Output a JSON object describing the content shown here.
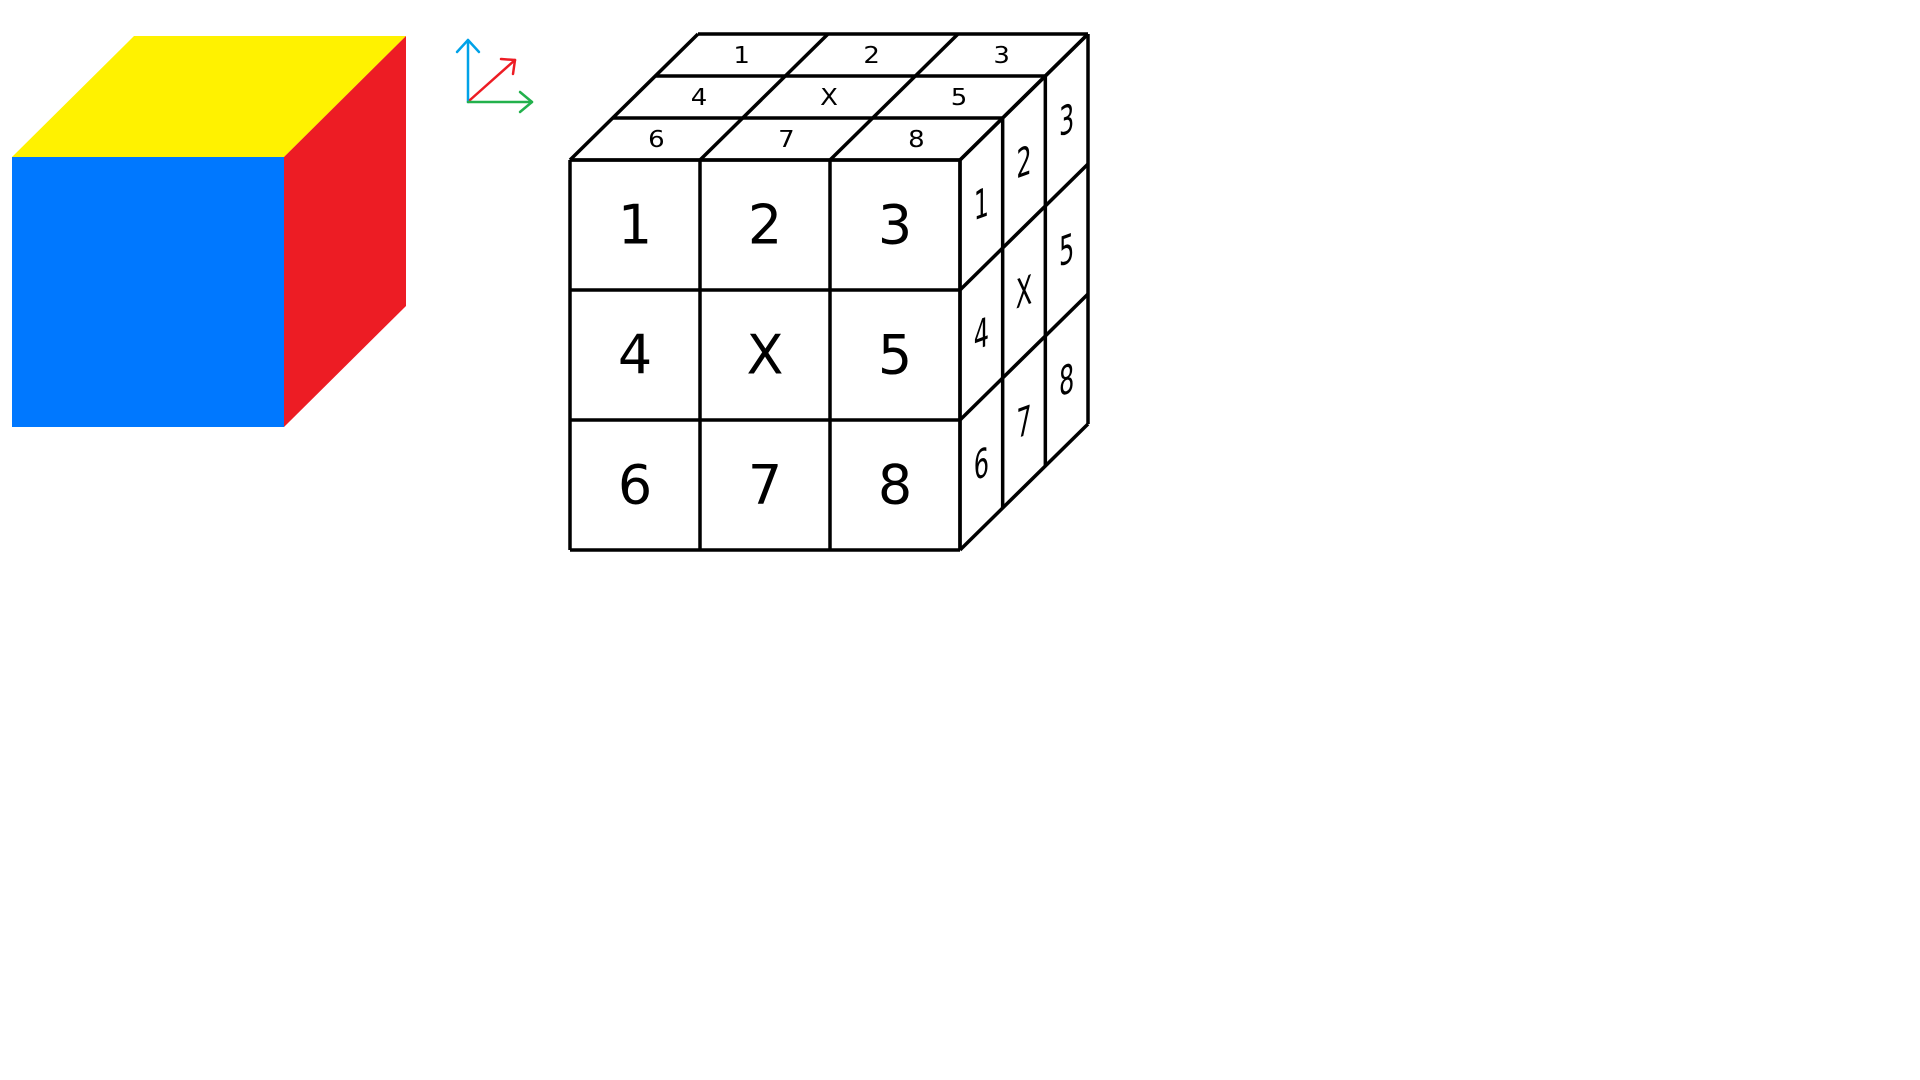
{
  "colors": {
    "outline": "#000000",
    "top_face": "#FFF200",
    "front_face": "#0078FF",
    "right_face": "#ED1C24",
    "axis_up": "#00A2E8",
    "axis_diagonal": "#ED1C24",
    "axis_right": "#22B14C"
  },
  "axes_legend": {
    "arrows": [
      "axis-up-arrow",
      "axis-diagonal-arrow",
      "axis-right-arrow"
    ]
  },
  "numbered_cube": {
    "front_face": [
      [
        "1",
        "2",
        "3"
      ],
      [
        "4",
        "X",
        "5"
      ],
      [
        "6",
        "7",
        "8"
      ]
    ],
    "top_face": [
      [
        "1",
        "2",
        "3"
      ],
      [
        "4",
        "X",
        "5"
      ],
      [
        "6",
        "7",
        "8"
      ]
    ],
    "right_face": [
      [
        "1",
        "2",
        "3"
      ],
      [
        "4",
        "X",
        "5"
      ],
      [
        "6",
        "7",
        "8"
      ]
    ]
  }
}
